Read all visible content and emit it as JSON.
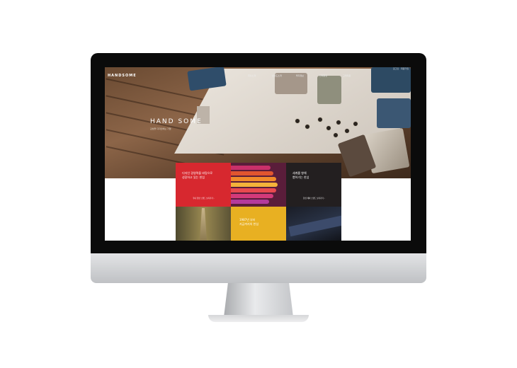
{
  "site": {
    "logo": "HANDSOME",
    "util_links": [
      "로그인",
      "회원가입"
    ],
    "nav": [
      "회사소개",
      "브랜드소개",
      "투자정보",
      "인재경영",
      "고객지원"
    ],
    "hero_title": "HAND SOME",
    "hero_subtitle": "감성을 디자인하는 기업"
  },
  "tiles": {
    "design": {
      "text": [
        "디자인 경영력을 바탕으로",
        "성장하고 있는 한섬"
      ],
      "link": "국내 한섬 브랜드 보러가기 ›",
      "color": "#d7282f"
    },
    "global": {
      "text": [
        "세계를 향해",
        "뻗어가는 한섬"
      ],
      "link": "한섬 해외 브랜드 보러가기 ›",
      "color": "#231f20"
    },
    "history": {
      "text": [
        "1987년 부터",
        "지금까지의 한섬"
      ],
      "color": "#e8b022"
    }
  }
}
